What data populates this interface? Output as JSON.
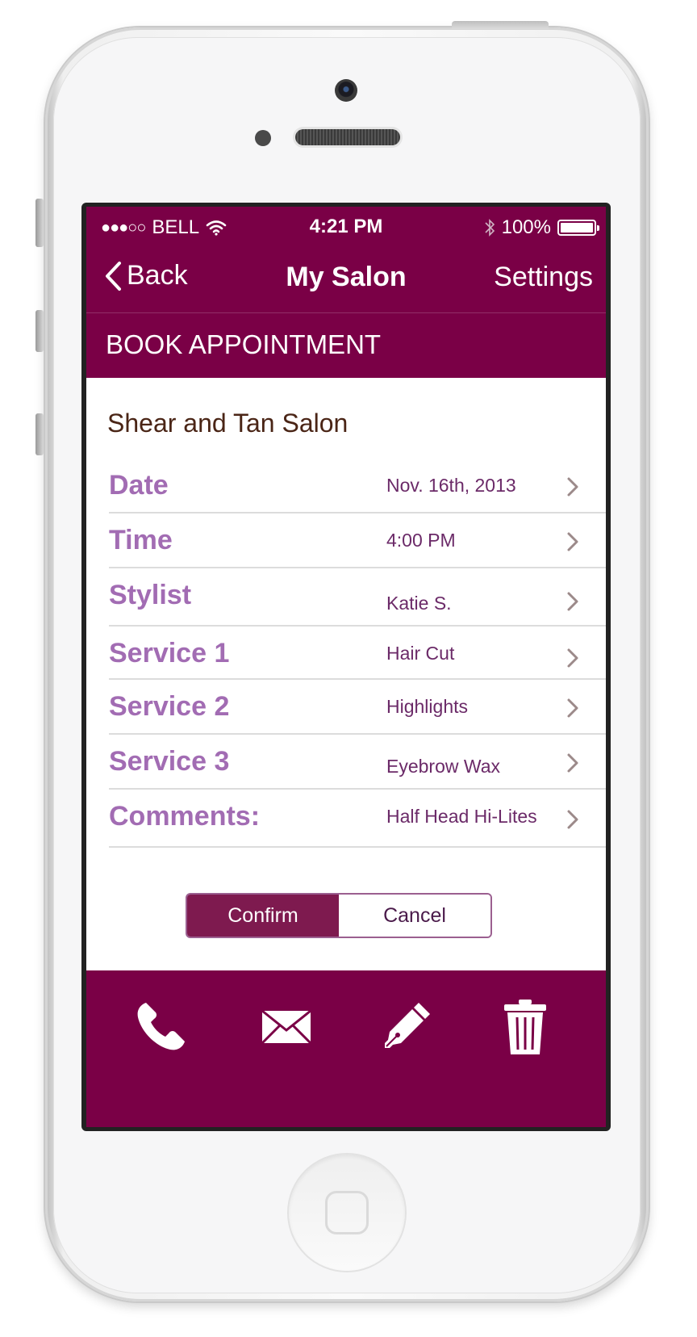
{
  "status_bar": {
    "signal_dots": "●●●○○",
    "carrier": "BELL",
    "time": "4:21 PM",
    "battery_percent": "100%",
    "battery_level": 1.0
  },
  "nav": {
    "back_label": "Back",
    "title": "My Salon",
    "settings_label": "Settings"
  },
  "section_header": "BOOK APPOINTMENT",
  "salon_name": "Shear and Tan Salon",
  "rows": [
    {
      "label": "Date",
      "value": "Nov. 16th, 2013"
    },
    {
      "label": "Time",
      "value": "4:00 PM"
    },
    {
      "label": "Stylist",
      "value": "Katie S."
    },
    {
      "label": "Service 1",
      "value": "Hair Cut"
    },
    {
      "label": "Service 2",
      "value": "Highlights"
    },
    {
      "label": "Service 3",
      "value": "Eyebrow Wax"
    },
    {
      "label": "Comments:",
      "value": "Half Head Hi-Lites"
    }
  ],
  "actions": {
    "confirm_label": "Confirm",
    "cancel_label": "Cancel"
  },
  "tab_bar": {
    "icons": [
      "phone-icon",
      "mail-icon",
      "pen-icon",
      "trash-icon"
    ]
  },
  "colors": {
    "brand": "#7a0046",
    "row_label": "#a26cb3",
    "row_value": "#6b2a68",
    "chevron": "#9c8a8a",
    "salon_name": "#4a2516"
  }
}
